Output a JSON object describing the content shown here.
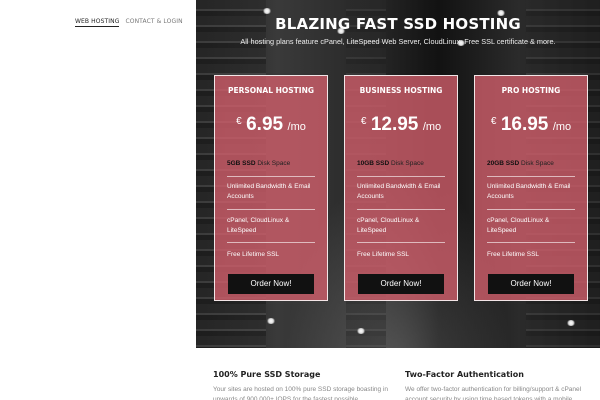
{
  "nav": {
    "items": [
      {
        "label": "WEB HOSTING",
        "active": true
      },
      {
        "label": "CONTACT & LOGIN",
        "active": false
      }
    ]
  },
  "hero": {
    "title": "BLAZING FAST SSD HOSTING",
    "subtitle": "All hosting plans feature cPanel, LiteSpeed Web Server, CloudLinux, Free SSL certificate & more."
  },
  "plans": [
    {
      "name": "PERSONAL HOSTING",
      "currency": "€",
      "amount": "6.95",
      "period": "/mo",
      "disk_bold": "5GB SSD",
      "disk_rest": " Disk Space",
      "f1": "Unlimited Bandwidth & Email Accounts",
      "f2": "cPanel, CloudLinux & LiteSpeed",
      "f3": "Free Lifetime SSL",
      "button": "Order Now!"
    },
    {
      "name": "BUSINESS HOSTING",
      "currency": "€",
      "amount": "12.95",
      "period": "/mo",
      "disk_bold": "10GB SSD",
      "disk_rest": " Disk Space",
      "f1": "Unlimited Bandwidth & Email Accounts",
      "f2": "cPanel, CloudLinux & LiteSpeed",
      "f3": "Free Lifetime SSL",
      "button": "Order Now!"
    },
    {
      "name": "PRO HOSTING",
      "currency": "€",
      "amount": "16.95",
      "period": "/mo",
      "disk_bold": "20GB SSD",
      "disk_rest": " Disk Space",
      "f1": "Unlimited Bandwidth & Email Accounts",
      "f2": "cPanel, CloudLinux & LiteSpeed",
      "f3": "Free Lifetime SSL",
      "button": "Order Now!"
    }
  ],
  "features": [
    {
      "title": "100% Pure SSD Storage",
      "text": "Your sites are hosted on 100% pure SSD storage boasting in upwards of 900,000+ IOPS for the fastest possible"
    },
    {
      "title": "Two-Factor Authentication",
      "text": "We offer two-factor authentication for billing/support & cPanel account security by using time based tokens with a mobile"
    }
  ],
  "colors": {
    "card": "#d35f6b",
    "button": "#111111"
  }
}
